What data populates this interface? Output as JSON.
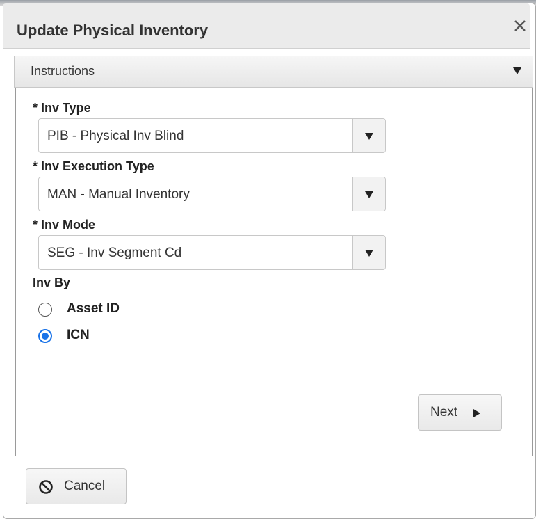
{
  "dialog": {
    "title": "Update Physical Inventory",
    "close_icon": "close-icon"
  },
  "instructions": {
    "label": "Instructions",
    "expand_icon": "chevron-down-icon"
  },
  "form": {
    "inv_type": {
      "label": "* Inv Type",
      "value": "PIB - Physical Inv Blind"
    },
    "inv_execution_type": {
      "label": "* Inv Execution Type",
      "value": "MAN - Manual Inventory"
    },
    "inv_mode": {
      "label": "* Inv Mode",
      "value": "SEG - Inv Segment Cd"
    },
    "inv_by": {
      "label": "Inv By",
      "options": [
        {
          "label": "Asset ID",
          "selected": false
        },
        {
          "label": "ICN",
          "selected": true
        }
      ]
    }
  },
  "buttons": {
    "next_label": "Next",
    "cancel_label": "Cancel",
    "cancel_icon": "cancel-icon"
  },
  "colors": {
    "radio_selected": "#1a73e8",
    "title_bar": "#ebebeb"
  }
}
